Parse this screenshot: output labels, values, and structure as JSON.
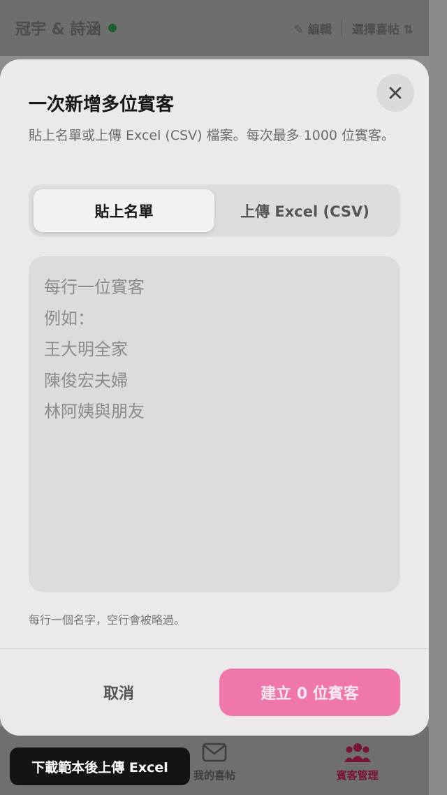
{
  "background": {
    "header_title": "冠宇 & 詩涵",
    "edit_label": "編輯",
    "select_invite_label": "選擇喜帖",
    "nav": [
      {
        "label": "",
        "icon": "grid-icon"
      },
      {
        "label": "我的喜帖",
        "icon": "envelope-icon"
      },
      {
        "label": "賓客管理",
        "icon": "people-icon"
      }
    ]
  },
  "modal": {
    "title": "一次新增多位賓客",
    "description": "貼上名單或上傳 Excel (CSV) 檔案。每次最多 1000 位賓客。",
    "tabs": [
      {
        "label": "貼上名單",
        "active": true
      },
      {
        "label": "上傳 Excel (CSV)",
        "active": false
      }
    ],
    "textarea": {
      "value": "",
      "placeholder": "每行一位賓客\n例如：\n王大明全家\n陳俊宏夫婦\n林阿姨與朋友"
    },
    "hint": "每行一個名字，空行會被略過。",
    "cancel_label": "取消",
    "create_label": "建立 0 位賓客"
  },
  "toast": {
    "text": "下載範本後上傳 Excel"
  },
  "colors": {
    "accent": "#f077a9",
    "active_nav": "#7a1232"
  }
}
